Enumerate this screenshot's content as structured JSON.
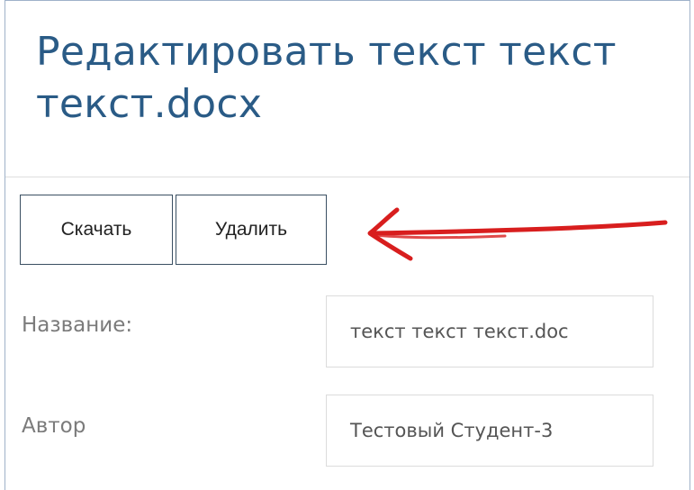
{
  "header": {
    "title": "Редактировать текст текст текст.docx"
  },
  "toolbar": {
    "download_label": "Скачать",
    "delete_label": "Удалить"
  },
  "form": {
    "name_label": "Название:",
    "name_value": "текст текст текст.doc",
    "author_label": "Автор",
    "author_value": "Тестовый Студент-3"
  },
  "annotation": {
    "arrow_color": "#d81e1e",
    "arrow_icon": "hand-drawn-arrow-left-icon"
  },
  "colors": {
    "title": "#2a5b86",
    "button_border": "#3a4f62",
    "label": "#7b7b7b"
  }
}
